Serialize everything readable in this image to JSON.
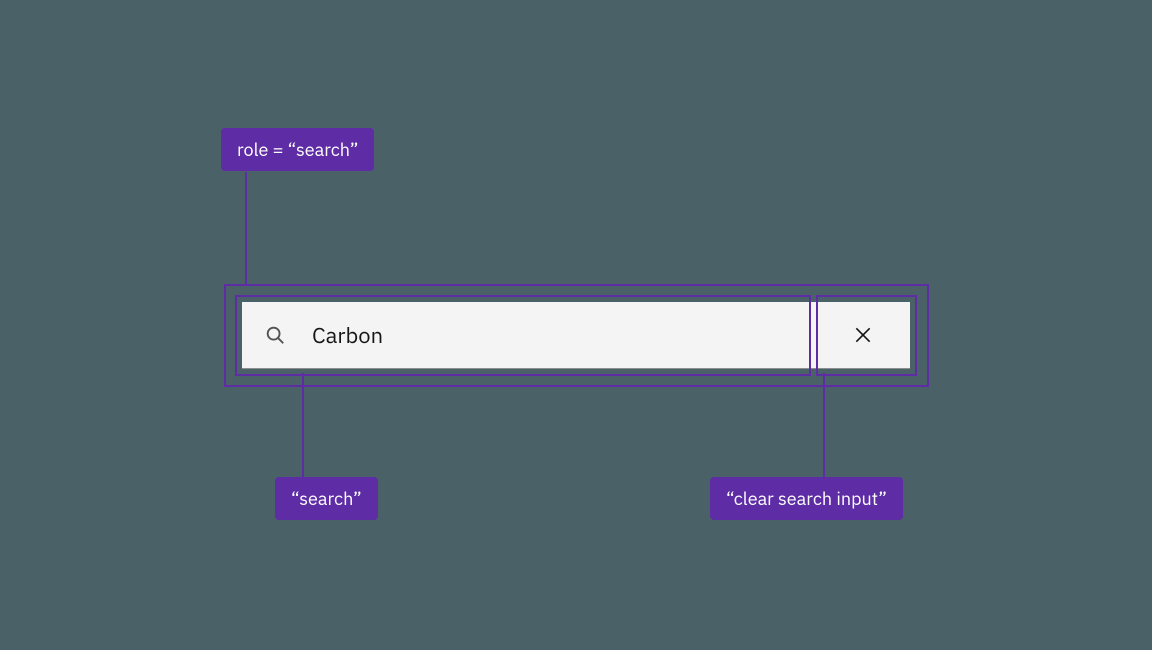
{
  "annotations": {
    "role": "role = “search”",
    "search": "“search”",
    "clear": "“clear search input”"
  },
  "search": {
    "value": "Carbon",
    "icons": {
      "magnify": "search-icon",
      "close": "close-icon"
    }
  },
  "colors": {
    "background": "#4b6168",
    "annotation": "#5e2ca5",
    "annotationText": "#ffffff",
    "inputBg": "#f4f4f4",
    "inputText": "#161616",
    "iconColor": "#525252"
  }
}
